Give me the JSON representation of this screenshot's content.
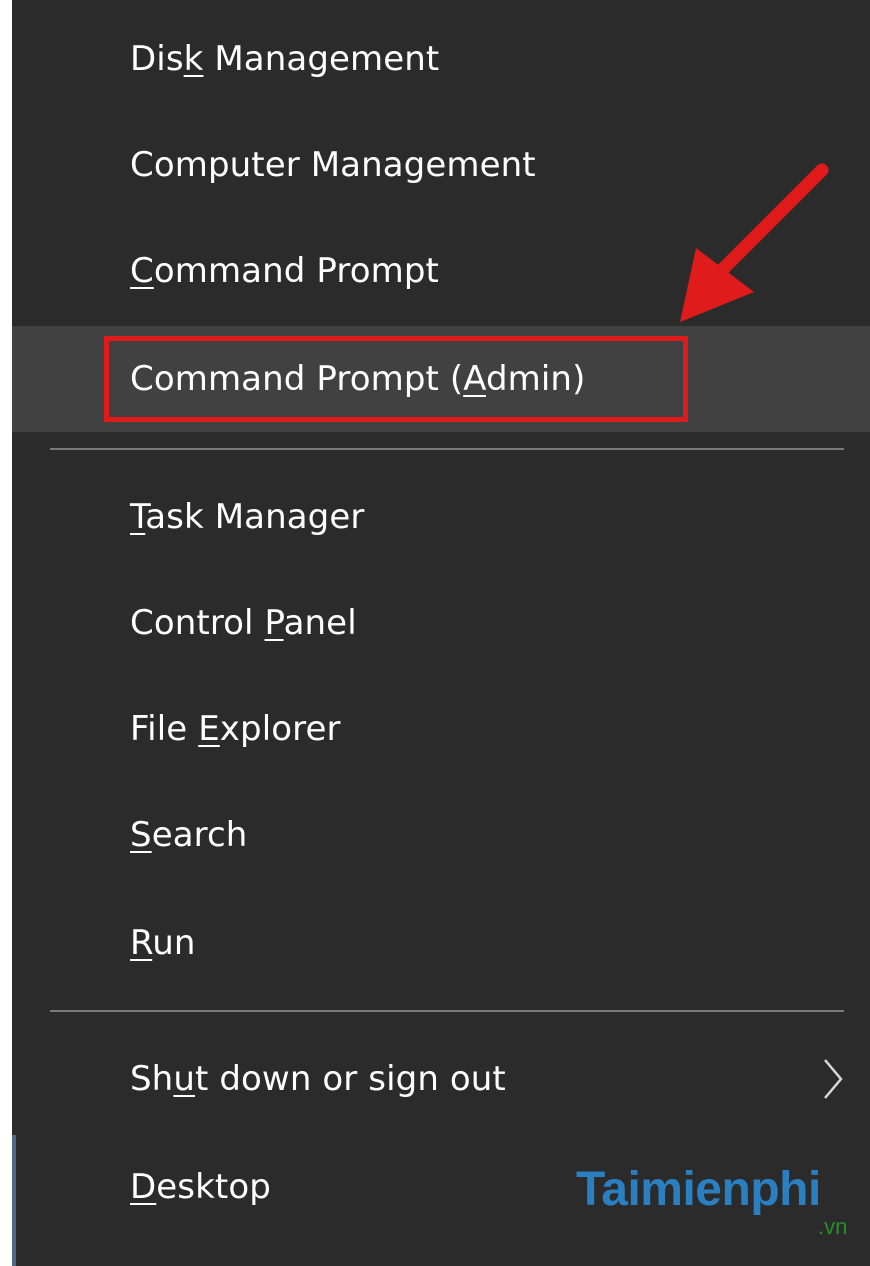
{
  "menu": {
    "items": [
      {
        "pre": "Dis",
        "u": "k",
        "post": " Management"
      },
      {
        "pre": "Computer Management",
        "u": "",
        "post": ""
      },
      {
        "pre": "",
        "u": "C",
        "post": "ommand Prompt"
      },
      {
        "pre": "Command Prompt (",
        "u": "A",
        "post": "dmin)"
      },
      {
        "pre": "",
        "u": "T",
        "post": "ask Manager"
      },
      {
        "pre": "Control ",
        "u": "P",
        "post": "anel"
      },
      {
        "pre": "File ",
        "u": "E",
        "post": "xplorer"
      },
      {
        "pre": "",
        "u": "S",
        "post": "earch"
      },
      {
        "pre": "",
        "u": "R",
        "post": "un"
      },
      {
        "pre": "Sh",
        "u": "u",
        "post": "t down or sign out"
      },
      {
        "pre": "",
        "u": "D",
        "post": "esktop"
      }
    ],
    "selected_index": 3,
    "submenu_icon": "chevron-right-icon"
  },
  "annotation": {
    "highlight_color": "#e01b1b",
    "arrow_icon": "red-arrow-icon"
  },
  "watermark": {
    "text": "Taimienphi",
    "suffix": ".vn"
  },
  "colors": {
    "menu_bg": "#2b2b2b",
    "selected_bg": "#414141",
    "separator": "#7a7a7a",
    "text": "#ffffff"
  }
}
